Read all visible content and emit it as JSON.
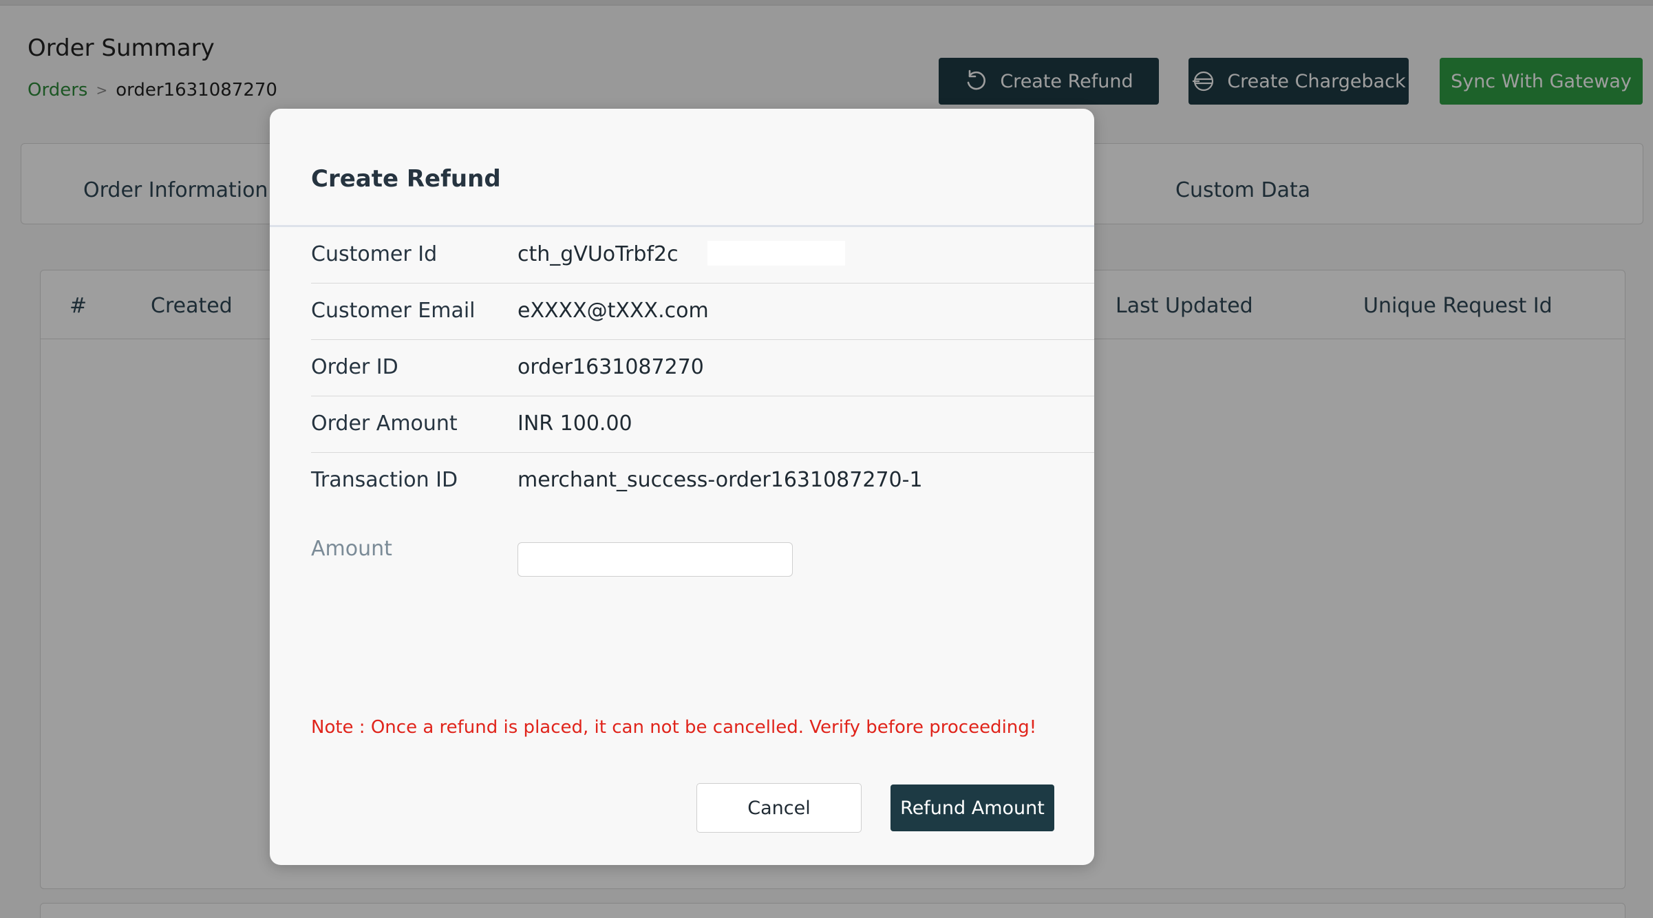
{
  "page": {
    "title": "Order Summary",
    "breadcrumb": {
      "parent": "Orders",
      "separator": ">",
      "current": "order1631087270"
    }
  },
  "actions": {
    "create_refund": "Create Refund",
    "create_chargeback": "Create Chargeback",
    "sync_gateway": "Sync With Gateway"
  },
  "tabs": [
    {
      "label": "Order Information"
    },
    {
      "label": "Custom Data"
    }
  ],
  "table": {
    "headers": [
      "#",
      "Created",
      "Last Updated",
      "Unique Request Id"
    ]
  },
  "modal": {
    "title": "Create Refund",
    "details": [
      {
        "label": "Customer Id",
        "value": "cth_gVUoTrbf2c"
      },
      {
        "label": "Customer Email",
        "value": "eXXXX@tXXX.com"
      },
      {
        "label": "Order ID",
        "value": "order1631087270"
      },
      {
        "label": "Order Amount",
        "value": "INR 100.00"
      },
      {
        "label": "Transaction ID",
        "value": "merchant_success-order1631087270-1"
      }
    ],
    "amount_label": "Amount",
    "amount_value": "",
    "note": "Note : Once a refund is placed, it can not be cancelled. Verify before proceeding!",
    "cancel_label": "Cancel",
    "submit_label": "Refund Amount"
  },
  "colors": {
    "dark_button": "#1d3a44",
    "green_button": "#2f9e44",
    "link_green": "#2e8b3a",
    "note_red": "#e0241b"
  },
  "icons": {
    "refund": "refresh-ccw-icon",
    "chargeback": "chargeback-icon"
  }
}
